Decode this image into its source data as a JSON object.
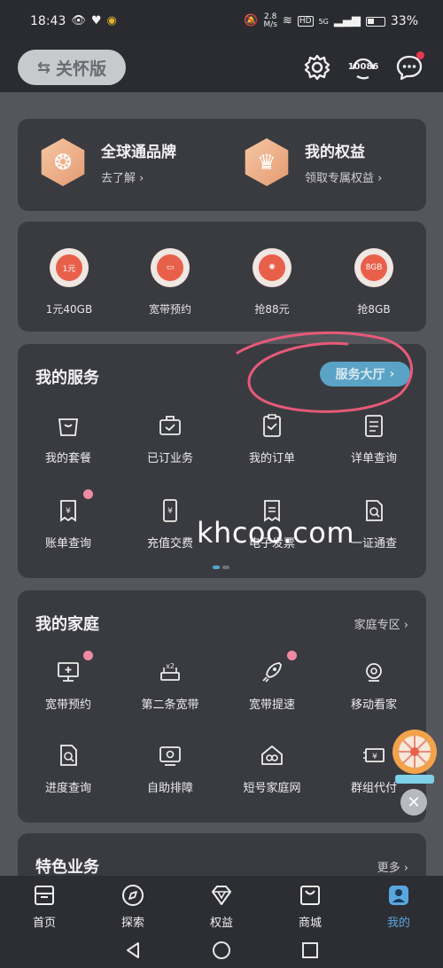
{
  "status_bar": {
    "time": "18:43",
    "network_speed_value": "2.8",
    "network_speed_unit": "M/s",
    "hd_label": "HD",
    "signal_label": "5G",
    "battery": "33%"
  },
  "top_bar": {
    "care_mode_label": "关怀版",
    "hotline": "10086",
    "icons": [
      "settings-icon",
      "customer-service-icon",
      "message-icon"
    ]
  },
  "benefits": [
    {
      "title": "全球通品牌",
      "subtitle": "去了解"
    },
    {
      "title": "我的权益",
      "subtitle": "领取专属权益"
    }
  ],
  "promos": [
    {
      "label": "1元40GB",
      "badge": "1元"
    },
    {
      "label": "宽带预约",
      "badge": ""
    },
    {
      "label": "抢88元",
      "badge": ""
    },
    {
      "label": "抢8GB",
      "badge": "8GB"
    }
  ],
  "my_services": {
    "title": "我的服务",
    "hall_button": "服务大厅",
    "items": [
      {
        "label": "我的套餐",
        "icon": "bag-icon"
      },
      {
        "label": "已订业务",
        "icon": "briefcase-icon"
      },
      {
        "label": "我的订单",
        "icon": "clipboard-icon"
      },
      {
        "label": "详单查询",
        "icon": "list-icon"
      },
      {
        "label": "账单查询",
        "icon": "bill-icon"
      },
      {
        "label": "充值交费",
        "icon": "phone-yuan-icon"
      },
      {
        "label": "电子发票",
        "icon": "invoice-icon"
      },
      {
        "label": "一证通查",
        "icon": "id-search-icon"
      }
    ]
  },
  "watermark": "khcoo.com",
  "my_family": {
    "title": "我的家庭",
    "more": "家庭专区",
    "items": [
      {
        "label": "宽带预约",
        "icon": "monitor-icon"
      },
      {
        "label": "第二条宽带",
        "icon": "router-x2-icon"
      },
      {
        "label": "宽带提速",
        "icon": "rocket-icon"
      },
      {
        "label": "移动看家",
        "icon": "camera-icon"
      },
      {
        "label": "进度查询",
        "icon": "doc-search-icon"
      },
      {
        "label": "自助排障",
        "icon": "device-icon"
      },
      {
        "label": "短号家庭网",
        "icon": "home-link-icon"
      },
      {
        "label": "群组代付",
        "icon": "pay-group-icon"
      }
    ]
  },
  "special": {
    "title": "特色业务",
    "more": "更多"
  },
  "tabs": [
    {
      "label": "首页",
      "icon": "home-icon"
    },
    {
      "label": "探索",
      "icon": "compass-icon"
    },
    {
      "label": "权益",
      "icon": "diamond-icon"
    },
    {
      "label": "商城",
      "icon": "shop-icon"
    },
    {
      "label": "我的",
      "icon": "user-icon"
    }
  ],
  "colors": {
    "accent": "#5aa7e0",
    "hall_button": "#5aa3c6",
    "annotation": "#e65a78",
    "badge_gradient": "#e39a70"
  }
}
